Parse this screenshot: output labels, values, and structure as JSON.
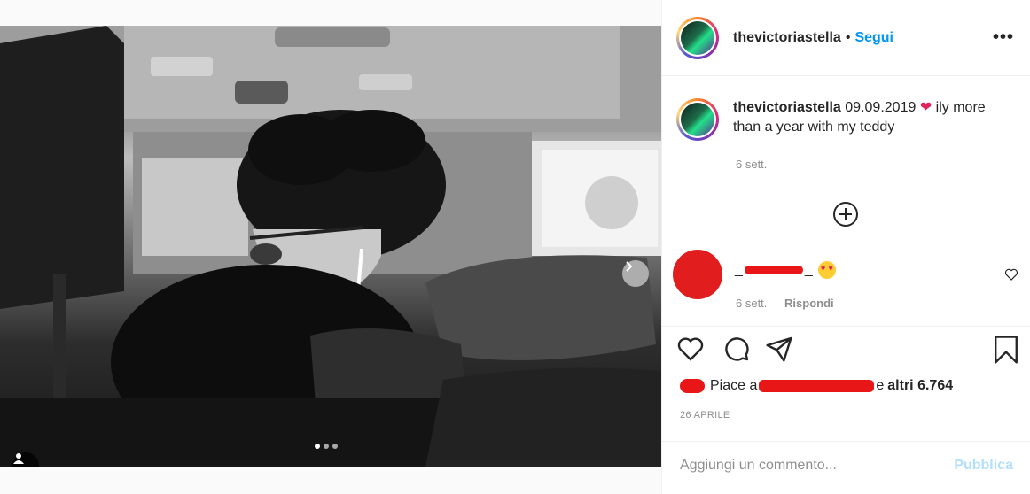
{
  "post": {
    "dots_count": 3,
    "active_dot": 0
  },
  "header": {
    "username": "thevictoriastella",
    "bullet": "•",
    "follow_label": "Segui",
    "more_label": "•••"
  },
  "caption": {
    "username": "thevictoriastella",
    "text_before": "09.09.2019",
    "heart": "❤",
    "text_after": "ily more than a year with my teddy",
    "time": "6 sett."
  },
  "comment": {
    "prefix": "_",
    "suffix": "_",
    "time": "6 sett.",
    "reply_label": "Rispondi"
  },
  "likes": {
    "prefix": "Piace a",
    "middle": "e",
    "others": "altri 6.764"
  },
  "date": "26 APRILE",
  "add_comment": {
    "placeholder": "Aggiungi un commento...",
    "publish_label": "Pubblica"
  },
  "colors": {
    "accent": "#0095f6",
    "publish_disabled": "#b2dffc",
    "redaction": "#e81616"
  }
}
